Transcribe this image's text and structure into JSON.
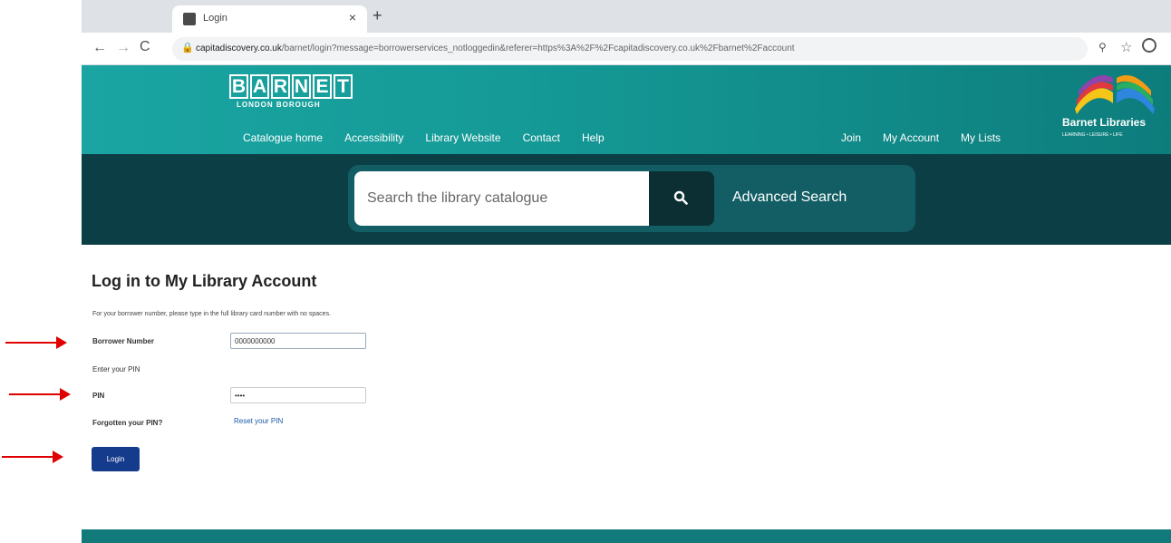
{
  "browser": {
    "tab_title": "Login",
    "tab_close": "×",
    "new_tab": "+",
    "url_host": "capitadiscovery.co.uk",
    "url_path": "/barnet/login?message=borrowerservices_notloggedin&referer=https%3A%2F%2Fcapitadiscovery.co.uk%2Fbarnet%2Faccount",
    "nav_back": "←",
    "nav_forward": "→",
    "reload": "C",
    "minimize": "–",
    "maximize": "□"
  },
  "header": {
    "logo_letters": [
      "B",
      "A",
      "R",
      "N",
      "E",
      "T"
    ],
    "logo_subtitle": "LONDON BOROUGH",
    "nav_left": [
      "Catalogue home",
      "Accessibility",
      "Library Website",
      "Contact",
      "Help"
    ],
    "nav_right": [
      "Join",
      "My Account",
      "My Lists"
    ],
    "brand_name": "Barnet Libraries",
    "brand_tagline": "LEARNING • LEISURE • LIFE",
    "colors": {
      "teal": "#1aa5a2",
      "dark": "#0c3e45"
    }
  },
  "search": {
    "placeholder": "Search the library catalogue",
    "advanced_label": "Advanced Search"
  },
  "login": {
    "title": "Log in to My Library Account",
    "instruction": "For your borrower number, please type in the full library card number with no spaces.",
    "borrower_label": "Borrower Number",
    "borrower_value": "0000000000",
    "enter_pin_text": "Enter your PIN",
    "pin_label": "PIN",
    "pin_value": "••••",
    "forgot_label": "Forgotten your PIN?",
    "reset_link": "Reset your PIN",
    "login_button": "Login",
    "colors": {
      "button": "#153b8c",
      "link": "#1a5aa8"
    }
  },
  "annotations": {
    "arrow_color": "#e00000"
  }
}
